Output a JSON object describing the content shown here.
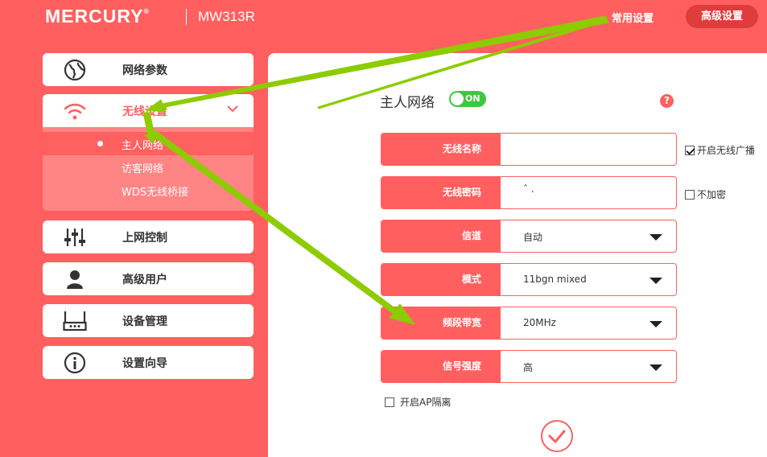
{
  "header": {
    "brand": "MERCURY",
    "brand_mark": "®",
    "model": "MW313R",
    "nav_common": "常用设置",
    "nav_advanced": "高级设置"
  },
  "sidebar": {
    "items": [
      {
        "label": "网络参数",
        "icon": "globe-icon"
      },
      {
        "label": "无线设置",
        "icon": "wifi-icon"
      },
      {
        "label": "上网控制",
        "icon": "sliders-icon"
      },
      {
        "label": "高级用户",
        "icon": "user-icon"
      },
      {
        "label": "设备管理",
        "icon": "router-icon"
      },
      {
        "label": "设置向导",
        "icon": "info-icon"
      }
    ],
    "wireless_sub": [
      {
        "label": "主人网络"
      },
      {
        "label": "访客网络"
      },
      {
        "label": "WDS无线桥接"
      }
    ]
  },
  "main": {
    "title": "主人网络",
    "toggle_label": "ON",
    "help": "?",
    "ssid": {
      "label": "无线名称",
      "value": ""
    },
    "password": {
      "label": "无线密码",
      "value": "ˆ      ."
    },
    "channel": {
      "label": "信道",
      "value": "自动"
    },
    "mode": {
      "label": "模式",
      "value": "11bgn mixed"
    },
    "bandwidth": {
      "label": "频段带宽",
      "value": "20MHz"
    },
    "power": {
      "label": "信号强度",
      "value": "高"
    },
    "broadcast": {
      "label": "开启无线广播",
      "checked": true
    },
    "no_encrypt": {
      "label": "不加密",
      "checked": false
    },
    "ap_isolation": {
      "label": "开启AP隔离",
      "checked": false
    }
  },
  "colors": {
    "accent": "#ff5f5f",
    "arrow": "#8ccc00",
    "toggle_on": "#3cc83c"
  }
}
